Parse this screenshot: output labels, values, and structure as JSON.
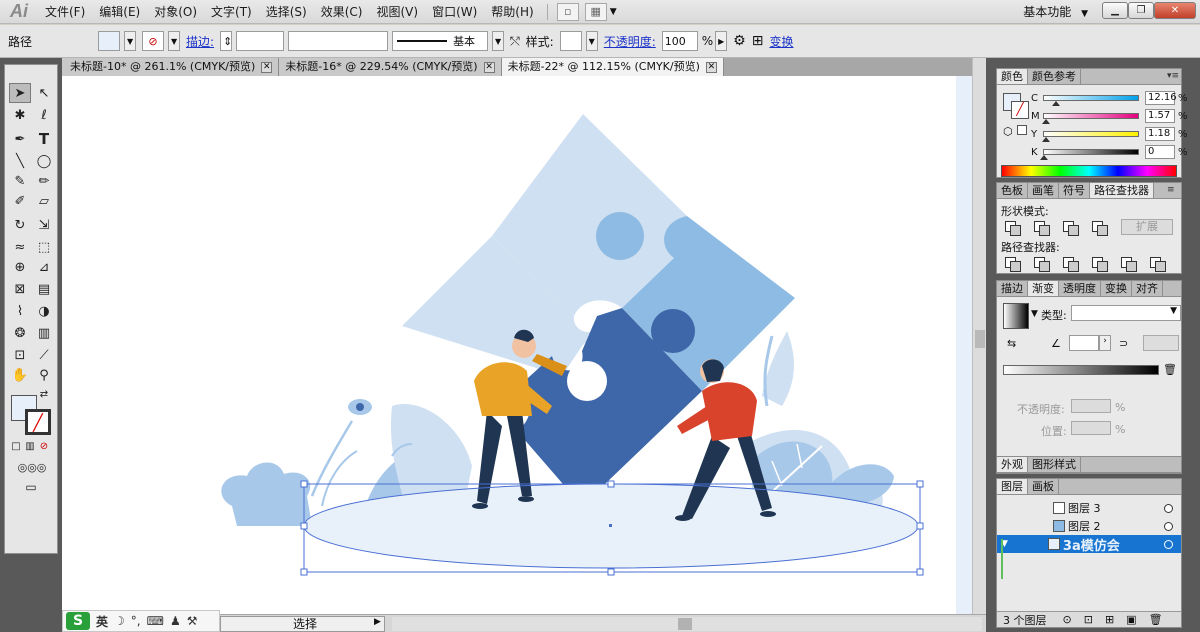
{
  "app": {
    "logo": "Ai",
    "menu": [
      "文件(F)",
      "编辑(E)",
      "对象(O)",
      "文字(T)",
      "选择(S)",
      "效果(C)",
      "视图(V)",
      "窗口(W)",
      "帮助(H)"
    ],
    "workspace": "基本功能"
  },
  "control_bar": {
    "object_type": "路径",
    "stroke_label": "描边:",
    "stroke_profile": "基本",
    "style_label": "样式:",
    "opacity_label": "不透明度:",
    "opacity_value": "100",
    "opacity_unit": "%",
    "transform_label": "变换"
  },
  "tabs": [
    {
      "title": "未标题-10* @ 261.1% (CMYK/预览)"
    },
    {
      "title": "未标题-16* @ 229.54% (CMYK/预览)"
    },
    {
      "title": "未标题-22* @ 112.15% (CMYK/预览)"
    }
  ],
  "colors": {
    "light_blue": "#cfe0f2",
    "mid_blue": "#8dbbe3",
    "dark_blue": "#3d67a8",
    "ellipse_fill": "#e8f1fa",
    "shirt_yellow": "#e9a326",
    "shirt_red": "#d9432b",
    "pants_navy": "#1f3551",
    "skin": "#f1c2a1",
    "selection": "#4a6fd3"
  },
  "status": {
    "mode": "选择",
    "ime_logo": "S",
    "ime_lang": "英"
  },
  "color_panel": {
    "tabs": [
      "颜色",
      "颜色参考"
    ],
    "channels": [
      {
        "label": "C",
        "value": "12.16",
        "unit": "%"
      },
      {
        "label": "M",
        "value": "1.57",
        "unit": "%"
      },
      {
        "label": "Y",
        "value": "1.18",
        "unit": "%"
      },
      {
        "label": "K",
        "value": "0",
        "unit": "%"
      }
    ]
  },
  "pathfinder_panel": {
    "tabs": [
      "色板",
      "画笔",
      "符号",
      "路径查找器"
    ],
    "shape_modes": "形状模式:",
    "expand": "扩展",
    "pathfinders": "路径查找器:"
  },
  "gradient_panel": {
    "tabs": [
      "描边",
      "渐变",
      "透明度",
      "变换",
      "对齐"
    ],
    "type_label": "类型:",
    "opacity_label": "不透明度:",
    "location_label": "位置:",
    "percent": "%"
  },
  "appearance_panel": {
    "tabs": [
      "外观",
      "图形样式"
    ]
  },
  "layers_panel": {
    "tabs": [
      "图层",
      "画板"
    ],
    "layers": [
      {
        "name": "图层 3"
      },
      {
        "name": "图层 2"
      },
      {
        "name": ""
      }
    ],
    "watermark": "3a模仿会",
    "count": "3 个图层"
  }
}
